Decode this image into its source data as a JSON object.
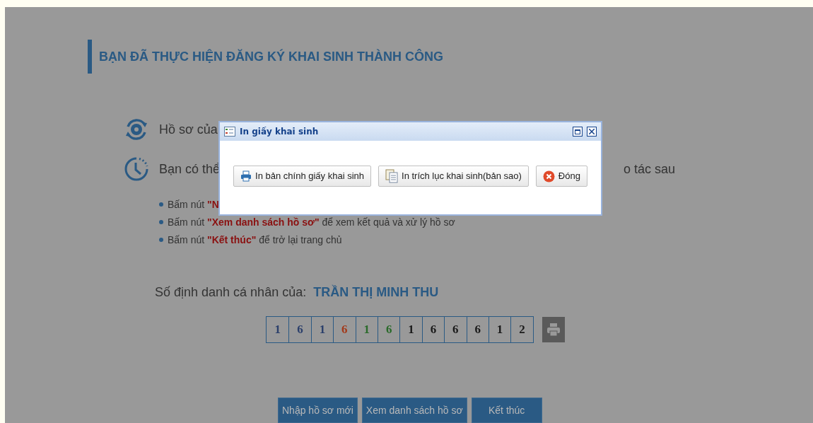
{
  "page": {
    "title": "BẠN ĐÃ THỰC HIỆN ĐĂNG KÝ KHAI SINH THÀNH CÔNG",
    "status_lines": [
      {
        "kind": "refresh",
        "text": "Hồ sơ của"
      },
      {
        "kind": "clock",
        "text": "Bạn có thể",
        "tail": "o tác sau"
      }
    ],
    "bullets": [
      {
        "prefix": "Bấm nút",
        "quoted": "\"N"
      },
      {
        "prefix": "Bấm nút",
        "quoted": "\"Xem danh sách hồ sơ\"",
        "suffix": "để xem kết quả và xử lý hồ sơ"
      },
      {
        "prefix": "Bấm nút",
        "quoted": "\"Kết thúc\"",
        "suffix": "để trở lại trang chủ"
      }
    ],
    "id_label": "Số định danh cá nhân của:",
    "person_name": "TRẦN THỊ MINH THU",
    "id_digits": [
      {
        "digit": "1",
        "color": "#2b3f6b"
      },
      {
        "digit": "6",
        "color": "#2b3f6b"
      },
      {
        "digit": "1",
        "color": "#2b3f6b"
      },
      {
        "digit": "6",
        "color": "#a33a1a"
      },
      {
        "digit": "1",
        "color": "#2a6a2a"
      },
      {
        "digit": "6",
        "color": "#2a6a2a"
      },
      {
        "digit": "1",
        "color": "#1a1a1a"
      },
      {
        "digit": "6",
        "color": "#1a1a1a"
      },
      {
        "digit": "6",
        "color": "#1a1a1a"
      },
      {
        "digit": "6",
        "color": "#1a1a1a"
      },
      {
        "digit": "1",
        "color": "#1a1a1a"
      },
      {
        "digit": "2",
        "color": "#1a1a1a"
      }
    ],
    "buttons": [
      "Nhập hồ sơ mới",
      "Xem danh sách hồ sơ",
      "Kết thúc"
    ]
  },
  "dialog": {
    "title": "In giấy khai sinh",
    "buttons": [
      {
        "kind": "print",
        "label": "In bản chính giấy khai sinh"
      },
      {
        "kind": "copy",
        "label": "In trích lục khai sinh(bản sao)"
      },
      {
        "kind": "close",
        "label": "Đóng"
      }
    ]
  }
}
